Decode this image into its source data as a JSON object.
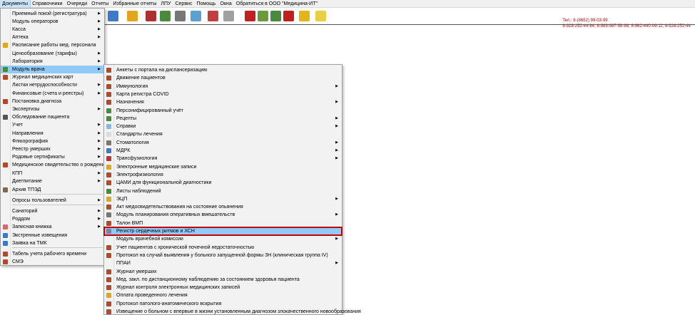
{
  "menubar": [
    "Документы",
    "Справочники",
    "Очереди",
    "Отчеты",
    "Избранные отчеты",
    "ЛПУ",
    "Сервис",
    "Помощь",
    "Окна",
    "Обратиться в ООО \"Медицина-ИТ\""
  ],
  "contacts": {
    "line1": "Тел.: 8-(8652) 99-03-99",
    "line2": "8-928-252-44-84; 8-989-987-58-88; 8-962-440-09-11; 8-928-252-44"
  },
  "menu1": [
    {
      "label": "Приемный покой (регистратура)",
      "arrow": true,
      "icon": ""
    },
    {
      "label": "Модуль операторов",
      "arrow": true,
      "icon": ""
    },
    {
      "label": "Касса",
      "arrow": true,
      "icon": ""
    },
    {
      "label": "Аптека",
      "arrow": true,
      "icon": ""
    },
    {
      "label": "Расписание работы мед. персонала",
      "arrow": false,
      "icon": "#e3a51c"
    },
    {
      "label": "Ценообразование (тарифы)",
      "arrow": true,
      "icon": ""
    },
    {
      "label": "Лаборатория",
      "arrow": true,
      "icon": ""
    },
    {
      "label": "Модуль врача",
      "arrow": true,
      "icon": "#4a8a3c"
    },
    {
      "label": "Журнал медицинских карт",
      "arrow": false,
      "icon": "#b04a2a"
    },
    {
      "label": "Листки нетрудоспособности",
      "arrow": true,
      "icon": ""
    },
    {
      "label": "Финансовые (счета и реестры)",
      "arrow": true,
      "icon": ""
    },
    {
      "label": "Постановка диагноза",
      "arrow": false,
      "icon": "#b04a2a"
    },
    {
      "label": "Экспертизы",
      "arrow": true,
      "icon": ""
    },
    {
      "label": "Обследование пациента",
      "arrow": false,
      "icon": "#555555"
    },
    {
      "label": "Учет",
      "arrow": true,
      "icon": ""
    },
    {
      "label": "Направления",
      "arrow": true,
      "icon": ""
    },
    {
      "label": "Флюорография",
      "arrow": true,
      "icon": ""
    },
    {
      "label": "Реестр умерших",
      "arrow": true,
      "icon": ""
    },
    {
      "label": "Родовые сертификаты",
      "arrow": true,
      "icon": ""
    },
    {
      "label": "Медицинское свидетельство о рождении",
      "arrow": false,
      "icon": "#b04a2a"
    },
    {
      "label": "КПП",
      "arrow": true,
      "icon": ""
    },
    {
      "label": "Диетпитание",
      "arrow": true,
      "icon": ""
    },
    {
      "label": "Архив ТПЭД",
      "arrow": false,
      "icon": "#7a6a50"
    },
    {
      "label": "Опросы пользователей",
      "arrow": true,
      "icon": ""
    },
    {
      "label": "Санаторий",
      "arrow": true,
      "icon": ""
    },
    {
      "label": "Роддом",
      "arrow": true,
      "icon": ""
    },
    {
      "label": "Записная книжка",
      "arrow": true,
      "icon": "#d46a6a"
    },
    {
      "label": "Экстренные извещения",
      "arrow": false,
      "icon": "#3c7ac8"
    },
    {
      "label": "Заявка на ТМК",
      "arrow": false,
      "icon": "#3c7ac8"
    },
    {
      "label": "Табель учета рабочего времени",
      "arrow": false,
      "icon": "#b04a2a"
    },
    {
      "label": "СМЭ",
      "arrow": false,
      "icon": "#b04a2a"
    }
  ],
  "menu2": [
    {
      "label": "Анкеты с портала на диспансеризацию",
      "arrow": false,
      "icon": "#b04a2a"
    },
    {
      "label": "Движение пациентов",
      "arrow": false,
      "icon": "#b04a2a"
    },
    {
      "label": "Иммунология",
      "arrow": true,
      "icon": "#b04a2a"
    },
    {
      "label": "Карта регистра COVID",
      "arrow": false,
      "icon": "#b04a2a"
    },
    {
      "label": "Назначения",
      "arrow": true,
      "icon": "#b04a2a"
    },
    {
      "label": "Персонифицированный учёт",
      "arrow": false,
      "icon": "#4a8a3c"
    },
    {
      "label": "Рецепты",
      "arrow": true,
      "icon": "#4a8a3c"
    },
    {
      "label": "Справки",
      "arrow": true,
      "icon": "#8cb6e0"
    },
    {
      "label": "Стандарты лечения",
      "arrow": false,
      "icon": "#dcdcdc"
    },
    {
      "label": "Стоматология",
      "arrow": true,
      "icon": "#777777"
    },
    {
      "label": "МДРК",
      "arrow": true,
      "icon": "#3c7ac8"
    },
    {
      "label": "Трансфузиология",
      "arrow": true,
      "icon": "#c03030"
    },
    {
      "label": "Электронные медицинские записи",
      "arrow": false,
      "icon": "#e3a51c"
    },
    {
      "label": "Электрофизиология",
      "arrow": false,
      "icon": "#b04a2a"
    },
    {
      "label": "ЦАМИ для функциональной диагностики",
      "arrow": false,
      "icon": "#b04a2a"
    },
    {
      "label": "Листы наблюдений",
      "arrow": false,
      "icon": "#4a8a3c"
    },
    {
      "label": "ЭЦП",
      "arrow": true,
      "icon": "#e3a51c"
    },
    {
      "label": "Акт медосвидетельствования на состояние опьянения",
      "arrow": false,
      "icon": "#b04a2a"
    },
    {
      "label": "Модуль планирования оперативных вмешательств",
      "arrow": true,
      "icon": "#777777"
    },
    {
      "label": "Талон ВМП",
      "arrow": false,
      "icon": "#b04a2a"
    },
    {
      "label": "Регистр сердечных ритмов и ХСН",
      "arrow": false,
      "icon": "#8a7aa0"
    },
    {
      "label": "Модуль врачебной комиссии",
      "arrow": true,
      "icon": ""
    },
    {
      "label": "Учет пациентов с хронической почечной недостаточностью",
      "arrow": false,
      "icon": "#b04a2a"
    },
    {
      "label": "Протокол на случай выявления у больного запущенной формы ЗН (клиническая группа IV)",
      "arrow": false,
      "icon": "#b04a2a"
    },
    {
      "label": "ППАИ",
      "arrow": true,
      "icon": ""
    },
    {
      "label": "Журнал умерших",
      "arrow": false,
      "icon": "#b04a2a"
    },
    {
      "label": "Мед. закл. по дистанционному наблюдению за состоянием здоровья пациента",
      "arrow": false,
      "icon": "#b04a2a"
    },
    {
      "label": "Журнал контроля электронных медицинских записей",
      "arrow": false,
      "icon": "#b04a2a"
    },
    {
      "label": "Оплата проведенного лечения",
      "arrow": false,
      "icon": "#e3a51c"
    },
    {
      "label": "Протокол патолого-анатомического вскрытия",
      "arrow": false,
      "icon": "#b04a2a"
    },
    {
      "label": "Извещение о больном с впервые в жизни установленным диагнозом злокачественного новообразования",
      "arrow": false,
      "icon": "#b04a2a"
    }
  ],
  "toolbar_icons": [
    "#3c7ac8",
    "#e3a51c",
    "#b03030",
    "#4a8a3c",
    "#777777",
    "#5aa0d0",
    "#c04040",
    "#a0a0a0",
    "#c02020",
    "#6a9a3c",
    "#4a8a3c",
    "#c02020",
    "#e3b51c",
    "#e8d040"
  ]
}
